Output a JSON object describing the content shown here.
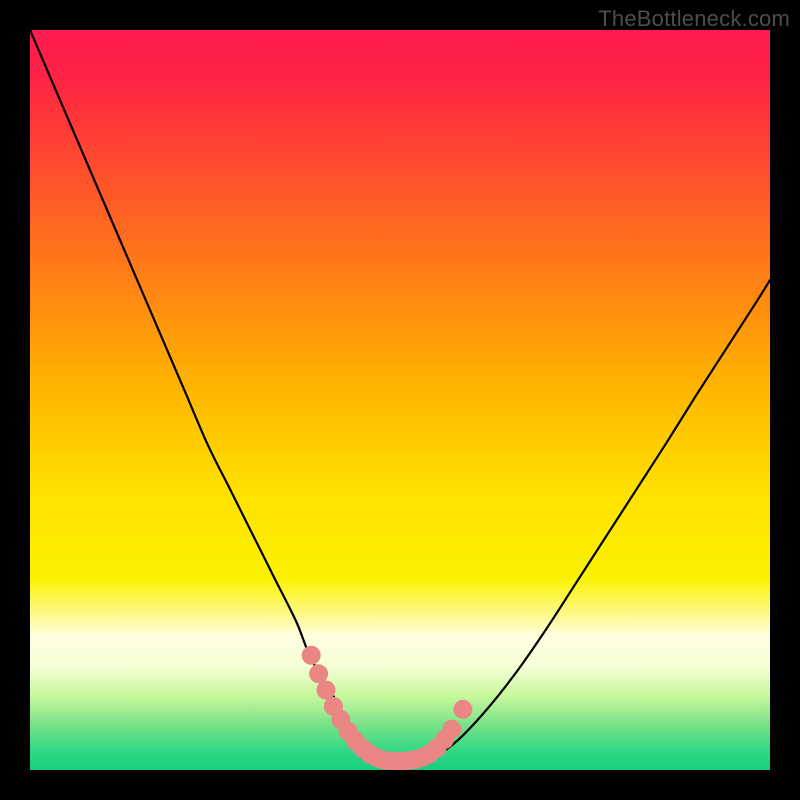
{
  "watermark": "TheBottleneck.com",
  "gradient_stops": [
    {
      "offset": 0.0,
      "color": "#ff1a50"
    },
    {
      "offset": 0.06,
      "color": "#ff2246"
    },
    {
      "offset": 0.18,
      "color": "#ff4a2d"
    },
    {
      "offset": 0.32,
      "color": "#ff7a18"
    },
    {
      "offset": 0.48,
      "color": "#ffb400"
    },
    {
      "offset": 0.62,
      "color": "#ffe000"
    },
    {
      "offset": 0.74,
      "color": "#fbf200"
    },
    {
      "offset": 0.82,
      "color": "#fffde0"
    },
    {
      "offset": 0.86,
      "color": "#f6ffd6"
    },
    {
      "offset": 0.9,
      "color": "#c8f89a"
    },
    {
      "offset": 0.94,
      "color": "#76e28a"
    },
    {
      "offset": 0.975,
      "color": "#2fd885"
    },
    {
      "offset": 1.0,
      "color": "#18cf7d"
    }
  ],
  "chart_data": {
    "type": "line",
    "title": "",
    "xlabel": "",
    "ylabel": "",
    "xlim": [
      0,
      100
    ],
    "ylim": [
      0,
      100
    ],
    "grid": false,
    "legend": false,
    "series": [
      {
        "name": "curve",
        "x": [
          0,
          3,
          6,
          9,
          12,
          15,
          18,
          21,
          24,
          27,
          30,
          33,
          36,
          38,
          41,
          43,
          45,
          47,
          49,
          51,
          53,
          55,
          58,
          62,
          66,
          70,
          74,
          78,
          82,
          86,
          90,
          94,
          98,
          100
        ],
        "y": [
          100,
          93,
          86,
          79,
          72,
          65,
          58,
          51,
          44,
          38,
          32,
          26,
          20,
          15,
          10,
          6.5,
          4,
          2.3,
          1.4,
          1.2,
          1.4,
          2.0,
          4.2,
          8.5,
          13.6,
          19.4,
          25.6,
          31.8,
          38.0,
          44.2,
          50.6,
          56.8,
          63.0,
          66.2
        ]
      }
    ],
    "markers": {
      "name": "pink-dots",
      "color": "#ea8684",
      "points": [
        {
          "x": 38.0,
          "y": 15.5
        },
        {
          "x": 39.0,
          "y": 13.0
        },
        {
          "x": 40.0,
          "y": 10.8
        },
        {
          "x": 41.0,
          "y": 8.6
        },
        {
          "x": 42.0,
          "y": 6.8
        },
        {
          "x": 43.0,
          "y": 5.2
        },
        {
          "x": 44.0,
          "y": 3.9
        },
        {
          "x": 45.0,
          "y": 2.9
        },
        {
          "x": 46.0,
          "y": 2.1
        },
        {
          "x": 47.0,
          "y": 1.6
        },
        {
          "x": 48.0,
          "y": 1.3
        },
        {
          "x": 49.0,
          "y": 1.2
        },
        {
          "x": 50.0,
          "y": 1.2
        },
        {
          "x": 51.0,
          "y": 1.25
        },
        {
          "x": 52.0,
          "y": 1.4
        },
        {
          "x": 53.0,
          "y": 1.7
        },
        {
          "x": 54.0,
          "y": 2.2
        },
        {
          "x": 55.0,
          "y": 3.0
        },
        {
          "x": 56.0,
          "y": 4.1
        },
        {
          "x": 57.0,
          "y": 5.5
        },
        {
          "x": 58.5,
          "y": 8.2
        }
      ]
    }
  }
}
